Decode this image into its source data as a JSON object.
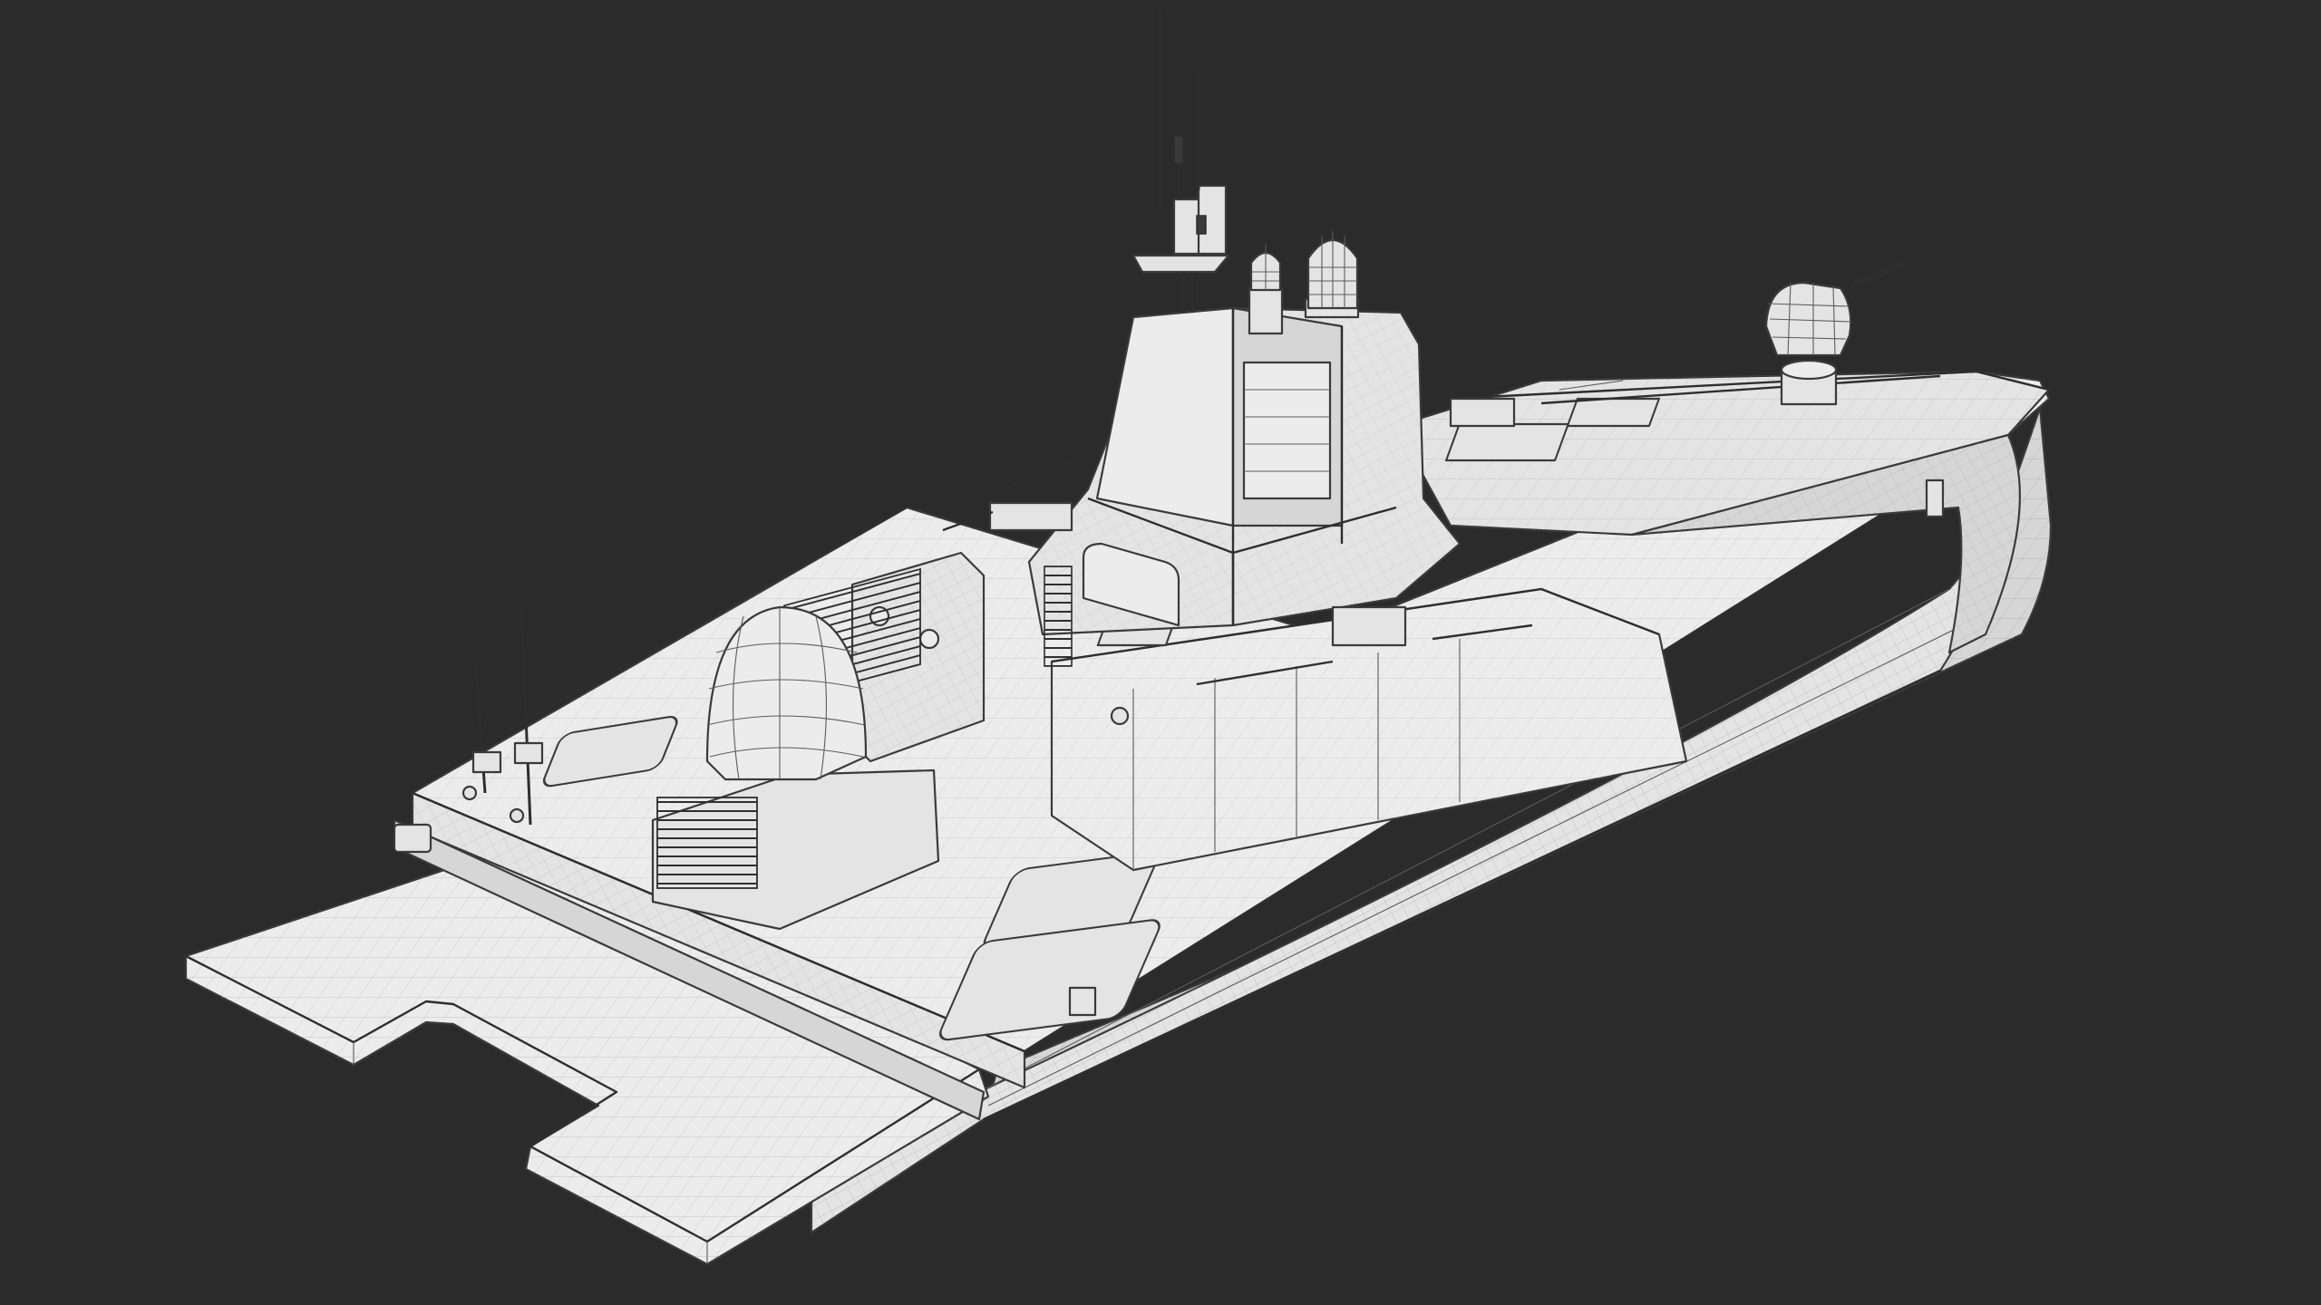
{
  "scene": {
    "subject": "patrol-boat-wireframe",
    "render_mode": "wireframe-on-shaded",
    "colors": {
      "background": "#2b2b2b",
      "surface": "#e4e4e4",
      "wire": "#3a3a3a"
    }
  }
}
